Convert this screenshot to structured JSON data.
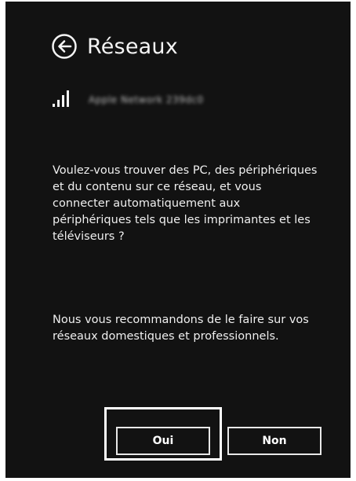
{
  "header": {
    "back_icon": "back-arrow-circle-icon",
    "title": "Réseaux"
  },
  "network": {
    "signal_icon": "wifi-signal-bars-icon",
    "signal_bars": 4,
    "name": "Apple Network 239dc0"
  },
  "body": {
    "question": "Voulez-vous trouver des PC, des périphériques et du contenu sur ce réseau, et vous connecter automatiquement aux périphériques tels que les imprimantes et les téléviseurs ?",
    "recommendation": "Nous vous recommandons de le faire sur vos réseaux domestiques et professionnels."
  },
  "buttons": {
    "yes_label": "Oui",
    "no_label": "Non",
    "focused": "yes"
  },
  "colors": {
    "background": "#121212",
    "text": "#f2f2f2",
    "button_border": "#e8e8e8",
    "focus_outline": "#ffffff"
  }
}
